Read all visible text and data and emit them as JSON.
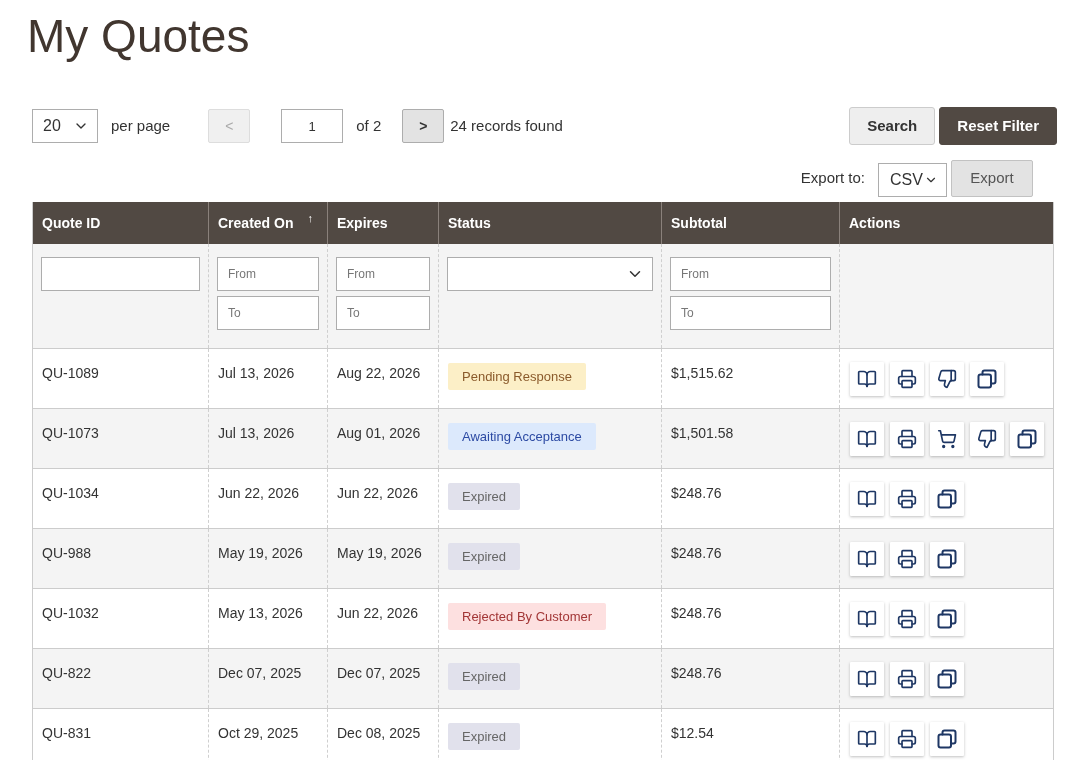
{
  "page": {
    "title": "My Quotes"
  },
  "toolbar": {
    "per_page": {
      "value": "20",
      "label": "per page"
    },
    "prev": {
      "label": "<",
      "disabled": true
    },
    "page_input": {
      "value": "1"
    },
    "page_total": "of 2",
    "next": {
      "label": ">",
      "disabled": false
    },
    "records": "24 records found",
    "buttons": [
      {
        "label": "Search",
        "kind": "secondary"
      },
      {
        "label": "Reset Filter",
        "kind": "primary"
      }
    ]
  },
  "export": {
    "label": "Export to:",
    "format": "CSV",
    "button": "Export"
  },
  "table": {
    "columns": [
      {
        "label": "Quote ID"
      },
      {
        "label": "Created On",
        "sort_indicator": "↑"
      },
      {
        "label": "Expires"
      },
      {
        "label": "Status"
      },
      {
        "label": "Subtotal"
      },
      {
        "label": "Actions"
      }
    ],
    "filters": [
      {
        "kind": "text"
      },
      {
        "kind": "range",
        "fields": [
          {
            "placeholder": "From"
          },
          {
            "placeholder": "To"
          }
        ]
      },
      {
        "kind": "range",
        "fields": [
          {
            "placeholder": "From"
          },
          {
            "placeholder": "To"
          }
        ]
      },
      {
        "kind": "select"
      },
      {
        "kind": "range",
        "fields": [
          {
            "placeholder": "From"
          },
          {
            "placeholder": "To"
          }
        ]
      }
    ],
    "rows": [
      {
        "quote_id": "QU-1089",
        "created_on": "Jul 13, 2026",
        "expires": "Aug 22, 2026",
        "status": {
          "label": "Pending Response",
          "color": "#fcefc7"
        },
        "subtotal": "$1,515.62",
        "actions": [
          {
            "kind": "view"
          },
          {
            "kind": "print"
          },
          {
            "kind": "decline"
          },
          {
            "kind": "copy"
          }
        ]
      },
      {
        "quote_id": "QU-1073",
        "created_on": "Jul 13, 2026",
        "expires": "Aug 01, 2026",
        "status": {
          "label": "Awaiting Acceptance",
          "color": "#dce9fc"
        },
        "subtotal": "$1,501.58",
        "actions": [
          {
            "kind": "view"
          },
          {
            "kind": "print"
          },
          {
            "kind": "order"
          },
          {
            "kind": "decline"
          },
          {
            "kind": "copy"
          }
        ]
      },
      {
        "quote_id": "QU-1034",
        "created_on": "Jun 22, 2026",
        "expires": "Jun 22, 2026",
        "status": {
          "label": "Expired",
          "color": "#e1e1ec"
        },
        "subtotal": "$248.76",
        "actions": [
          {
            "kind": "view"
          },
          {
            "kind": "print"
          },
          {
            "kind": "copy"
          }
        ]
      },
      {
        "quote_id": "QU-988",
        "created_on": "May 19, 2026",
        "expires": "May 19, 2026",
        "status": {
          "label": "Expired",
          "color": "#e1e1ec"
        },
        "subtotal": "$248.76",
        "actions": [
          {
            "kind": "view"
          },
          {
            "kind": "print"
          },
          {
            "kind": "copy"
          }
        ]
      },
      {
        "quote_id": "QU-1032",
        "created_on": "May 13, 2026",
        "expires": "Jun 22, 2026",
        "status": {
          "label": "Rejected By Customer",
          "color": "#fde0e0"
        },
        "subtotal": "$248.76",
        "actions": [
          {
            "kind": "view"
          },
          {
            "kind": "print"
          },
          {
            "kind": "copy"
          }
        ]
      },
      {
        "quote_id": "QU-822",
        "created_on": "Dec 07, 2025",
        "expires": "Dec 07, 2025",
        "status": {
          "label": "Expired",
          "color": "#e1e1ec"
        },
        "subtotal": "$248.76",
        "actions": [
          {
            "kind": "view"
          },
          {
            "kind": "print"
          },
          {
            "kind": "copy"
          }
        ]
      },
      {
        "quote_id": "QU-831",
        "created_on": "Oct 29, 2025",
        "expires": "Dec 08, 2025",
        "status": {
          "label": "Expired",
          "color": "#e1e1ec"
        },
        "subtotal": "$12.54",
        "actions": [
          {
            "kind": "view"
          },
          {
            "kind": "print"
          },
          {
            "kind": "copy"
          }
        ]
      }
    ]
  }
}
